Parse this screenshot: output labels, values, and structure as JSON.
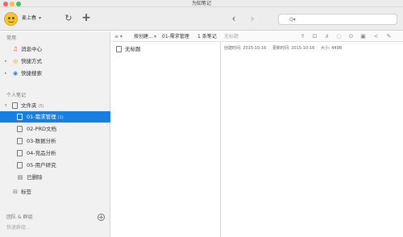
{
  "window": {
    "title": "为知笔记"
  },
  "toolbar": {
    "username": "麦上春",
    "search_placeholder": "Q▾"
  },
  "sidebar": {
    "section_common": "常用",
    "section_personal": "个人笔记",
    "section_team": "团队 & 群组",
    "items": [
      {
        "label": "消息中心"
      },
      {
        "label": "快捷方式"
      },
      {
        "label": "快捷搜索"
      },
      {
        "label": "文件夹",
        "count": "(5)"
      },
      {
        "label": "01-需求管理",
        "count": "(1)"
      },
      {
        "label": "02-PRD文档"
      },
      {
        "label": "03-数据分析"
      },
      {
        "label": "04-竞品分析"
      },
      {
        "label": "05-用户研究"
      },
      {
        "label": "已删除"
      },
      {
        "label": "标签"
      }
    ],
    "team_hint": "快速群组..."
  },
  "note_list": {
    "sort_label": "按创建...",
    "folder_label": "01-需求管理",
    "count_label": "1 条笔记",
    "notes": [
      {
        "title": "无标题"
      }
    ]
  },
  "editor": {
    "title": "无标题",
    "created": "创建时间: 2015-10-16",
    "updated": "更新时间: 2015-10-16",
    "size": "大小: 449B"
  }
}
